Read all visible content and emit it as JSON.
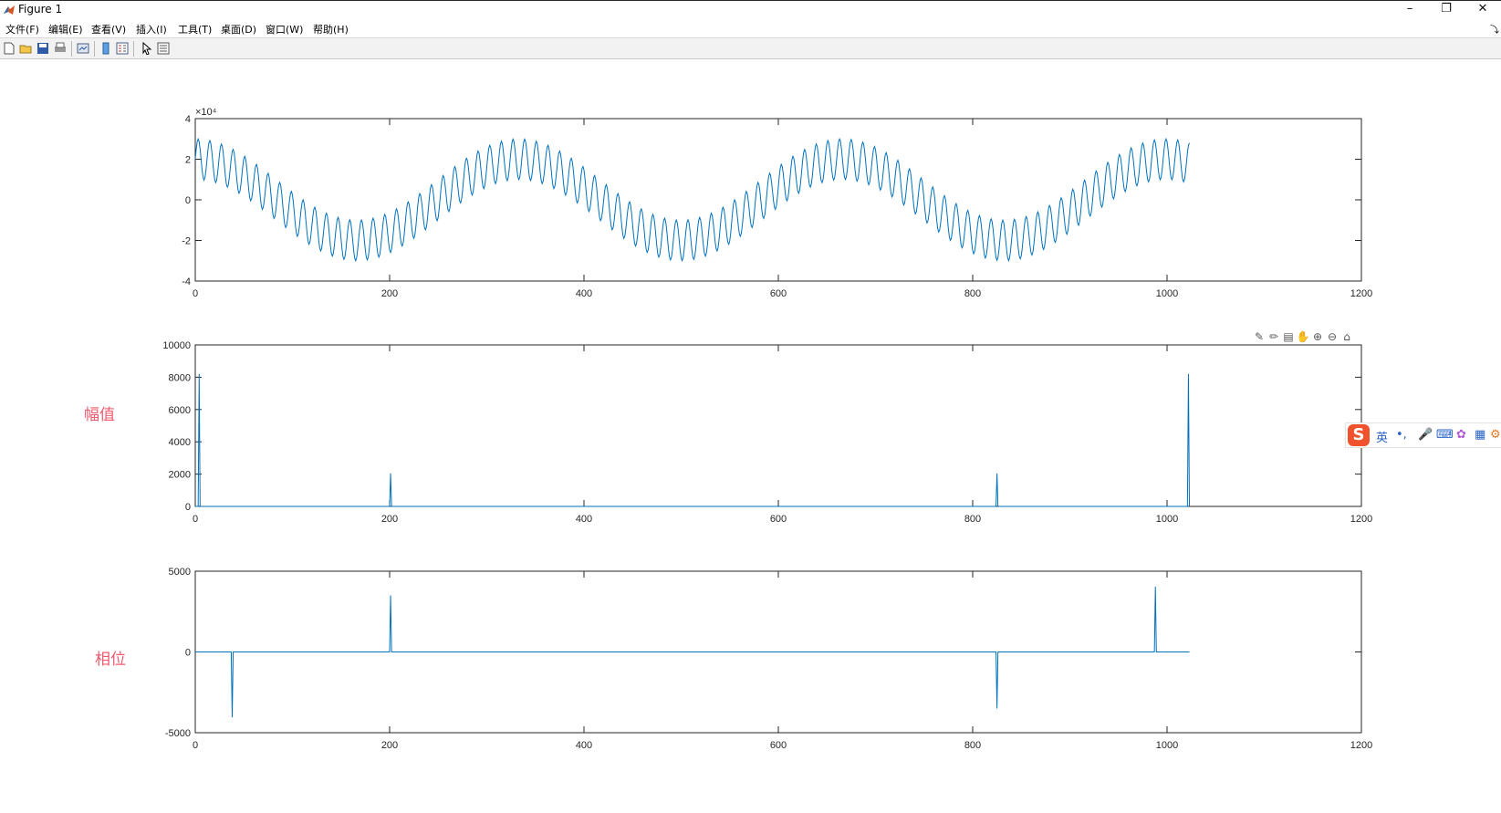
{
  "window": {
    "title": "Figure 1",
    "minimize_icon": "minimize-icon",
    "restore_icon": "restore-icon",
    "close_icon": "close-icon"
  },
  "menubar": {
    "items": [
      "文件(F)",
      "编辑(E)",
      "查看(V)",
      "插入(I)",
      "工具(T)",
      "桌面(D)",
      "窗口(W)",
      "帮助(H)"
    ]
  },
  "toolbar": {
    "icons": [
      "new-figure-icon",
      "open-file-icon",
      "save-icon",
      "print-icon",
      "link-plot-icon",
      "insert-colorbar-icon",
      "insert-legend-icon",
      "edit-plot-icon",
      "property-inspector-icon"
    ]
  },
  "axes_toolbar": {
    "icons": [
      "export-icon",
      "brush-icon",
      "data-tips-icon",
      "pan-icon",
      "zoom-in-icon",
      "zoom-out-icon",
      "home-icon"
    ]
  },
  "labels": {
    "magnitude": "幅值",
    "phase": "相位"
  },
  "ime": {
    "logo": "S",
    "mode": "英",
    "punct": "•,",
    "icons": [
      "microphone-icon",
      "keyboard-icon",
      "skin-icon",
      "toolbox-icon",
      "settings-icon"
    ]
  },
  "chart_data": [
    {
      "type": "line",
      "title": "",
      "xlabel": "",
      "ylabel": "",
      "xlim": [
        0,
        1200
      ],
      "ylim": [
        -4,
        4
      ],
      "exponent_label": "×10⁴",
      "xticks": [
        "0",
        "200",
        "400",
        "600",
        "800",
        "1000",
        "1200"
      ],
      "yticks": [
        "-4",
        "-2",
        "0",
        "2",
        "4"
      ],
      "line_color": "#0072bd",
      "signal": {
        "n": 1024,
        "low_amplitude": 2.0,
        "low_period_samples": 333,
        "high_amplitude": 1.0,
        "high_period_samples": 12
      }
    },
    {
      "type": "line",
      "title": "",
      "xlabel": "",
      "ylabel": "",
      "xlim": [
        0,
        1200
      ],
      "ylim": [
        0,
        10000
      ],
      "xticks": [
        "0",
        "200",
        "400",
        "600",
        "800",
        "1000",
        "1200"
      ],
      "yticks": [
        "0",
        "2000",
        "4000",
        "6000",
        "8000",
        "10000"
      ],
      "line_color": "#0072bd",
      "n": 1024,
      "baseline": 0,
      "peaks": [
        {
          "x": 4,
          "y": 8200
        },
        {
          "x": 201,
          "y": 2050
        },
        {
          "x": 825,
          "y": 2050
        },
        {
          "x": 1022,
          "y": 8200
        }
      ]
    },
    {
      "type": "line",
      "title": "",
      "xlabel": "",
      "ylabel": "",
      "xlim": [
        0,
        1200
      ],
      "ylim": [
        -5000,
        5000
      ],
      "xticks": [
        "0",
        "200",
        "400",
        "600",
        "800",
        "1000",
        "1200"
      ],
      "yticks": [
        "-5000",
        "0",
        "5000"
      ],
      "line_color": "#0072bd",
      "n": 1024,
      "baseline": 0,
      "peaks": [
        {
          "x": 38,
          "y": -4050
        },
        {
          "x": 201,
          "y": 3500
        },
        {
          "x": 825,
          "y": -3500
        },
        {
          "x": 988,
          "y": 4050
        }
      ]
    }
  ]
}
